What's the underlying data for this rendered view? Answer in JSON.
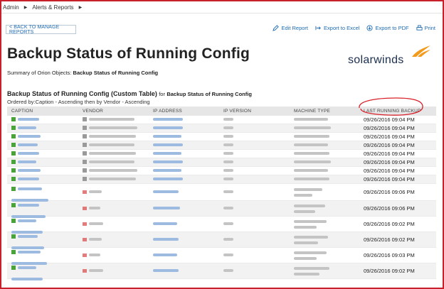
{
  "breadcrumb": {
    "items": [
      "Admin",
      "Alerts & Reports"
    ]
  },
  "back_button": "< BACK TO MANAGE REPORTS",
  "actions": {
    "edit": "Edit Report",
    "excel": "Export to Excel",
    "pdf": "Export to PDF",
    "print": "Print"
  },
  "page": {
    "title": "Backup Status of Running Config",
    "summary_label": "Summary of Orion Objects:",
    "summary_value": "Backup Status of Running Config"
  },
  "logo": {
    "text": "solarwinds"
  },
  "table_section": {
    "title": "Backup Status of Running Config (Custom Table)",
    "for_label": "for",
    "for_value": "Backup Status of Running Config",
    "ordered_by": "Ordered by:Caption - Ascending then by Vendor - Ascending"
  },
  "table": {
    "headers": [
      "CAPTION",
      "VENDOR",
      "IP ADDRESS",
      "IP VERSION",
      "MACHINE TYPE",
      "LAST RUNNING BACKUP"
    ],
    "rows": [
      "09/26/2016 09:04 PM",
      "09/26/2016 09:04 PM",
      "09/26/2016 09:04 PM",
      "09/26/2016 09:04 PM",
      "09/26/2016 09:04 PM",
      "09/26/2016 09:04 PM",
      "09/26/2016 09:04 PM",
      "09/26/2016 09:04 PM",
      "09/26/2016 09:06 PM",
      "09/26/2016 09:06 PM",
      "09/26/2016 09:02 PM",
      "09/26/2016 09:02 PM",
      "09/26/2016 09:03 PM",
      "09/26/2016 09:02 PM"
    ]
  },
  "colors": {
    "link": "#1e6cb5",
    "frame": "#c8202a",
    "annotation": "#d9202a",
    "brand_orange": "#f39a1d"
  }
}
